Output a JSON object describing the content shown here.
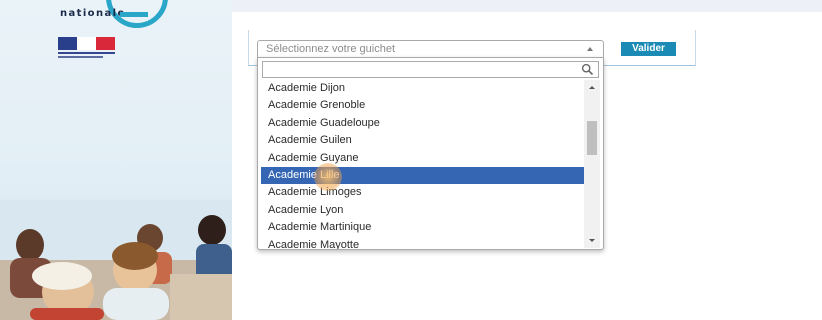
{
  "header": {
    "logo_text": "nationale"
  },
  "guichet": {
    "select_placeholder": "Sélectionnez votre guichet",
    "validate_label": "Valider",
    "search_value": "",
    "options": [
      "Academie Dijon",
      "Academie Grenoble",
      "Academie Guadeloupe",
      "Academie Guilen",
      "Academie Guyane",
      "Academie Lille",
      "Academie Limoges",
      "Academie Lyon",
      "Academie Martinique",
      "Academie Mayotte"
    ],
    "selected_option": "Academie Lille"
  },
  "colors": {
    "accent": "#1b8bb5",
    "highlight": "#3566b4",
    "logo_ring": "#2aa6c8",
    "flag_blue": "#2a3f8c",
    "flag_red": "#d8283a"
  },
  "icons": {
    "search": "search-icon",
    "select_arrow": "chevron-up-icon",
    "scroll_up": "scroll-up-arrow-icon",
    "scroll_down": "scroll-down-arrow-icon"
  }
}
